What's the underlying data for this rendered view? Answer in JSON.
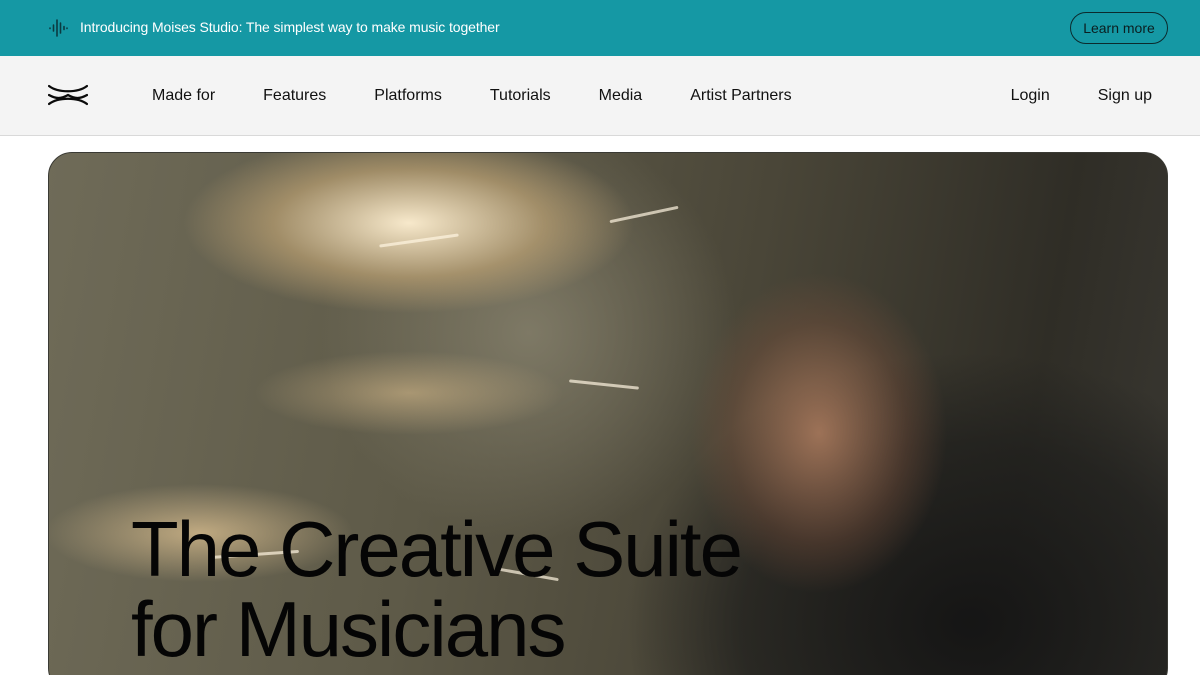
{
  "announcement": {
    "text": "Introducing Moises Studio: The simplest way to make music together",
    "cta_label": "Learn more",
    "icon": "audio-wave-icon",
    "background": "#1598a4"
  },
  "nav": {
    "logo_icon": "moises-wave-logo",
    "links": [
      {
        "label": "Made for"
      },
      {
        "label": "Features"
      },
      {
        "label": "Platforms"
      },
      {
        "label": "Tutorials"
      },
      {
        "label": "Media"
      },
      {
        "label": "Artist Partners"
      }
    ],
    "login_label": "Login",
    "signup_label": "Sign up"
  },
  "hero": {
    "headline_line1": "The Creative Suite",
    "headline_line2": "for Musicians",
    "image": "drummer-playing-in-studio"
  }
}
